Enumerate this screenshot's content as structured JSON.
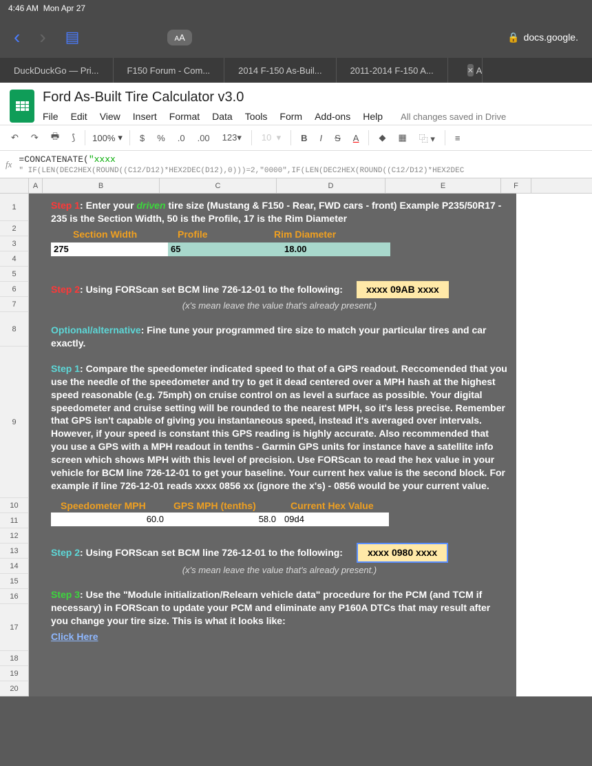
{
  "status": {
    "time": "4:46 AM",
    "date": "Mon Apr 27"
  },
  "browser": {
    "url_domain": "docs.google.",
    "font_label": "AA"
  },
  "tabs": [
    "DuckDuckGo — Pri...",
    "F150 Forum - Com...",
    "2014 F-150 As-Buil...",
    "2011-2014 F-150 A...",
    "A"
  ],
  "doc": {
    "title": "Ford As-Built Tire Calculator v3.0",
    "menus": [
      "File",
      "Edit",
      "View",
      "Insert",
      "Format",
      "Data",
      "Tools",
      "Form",
      "Add-ons",
      "Help"
    ],
    "save_status": "All changes saved in Drive",
    "zoom": "100%"
  },
  "formula": {
    "prefix": "=CONCATENATE(",
    "string": "\"xxxx",
    "line2": "\" IF(LEN(DEC2HEX(ROUND((C12/D12)*HEX2DEC(D12),0)))=2,\"0000\",IF(LEN(DEC2HEX(ROUND((C12/D12)*HEX2DEC"
  },
  "columns": [
    "A",
    "B",
    "C",
    "D",
    "E",
    "F"
  ],
  "rows": [
    "1",
    "2",
    "3",
    "4",
    "5",
    "6",
    "7",
    "8",
    "9",
    "10",
    "11",
    "12",
    "13",
    "14",
    "15",
    "16",
    "17",
    "18",
    "19",
    "20"
  ],
  "sheet": {
    "step1_a": "Step 1",
    "step1_b": ": Enter your ",
    "step1_c": "driven",
    "step1_d": " tire size (Mustang & F150 - Rear, FWD cars - front)  Example P235/50R17 - 235 is the Section Width, 50 is the Profile, 17 is the Rim Diameter",
    "labels": {
      "sw": "Section Width",
      "pr": "Profile",
      "rd": "Rim Diameter"
    },
    "inputs": {
      "sw": "275",
      "pr": "65",
      "rd": "18.00"
    },
    "step2_a": "Step 2",
    "step2_b": ": Using FORScan set BCM line 726-12-01 to the following:",
    "result1": "xxxx 09AB xxxx",
    "note": "(x's mean leave the value that's already present.)",
    "opt_a": "Optional/alternative",
    "opt_b": ": Fine tune your programmed tire size to match your particular tires and car exactly.",
    "alt_s1_a": "Step 1",
    "alt_s1_b": ": Compare the speedometer indicated speed to that of a GPS readout. Reccomended that you use the needle of the speedometer and try to get it dead centered over a MPH hash at the highest speed reasonable (e.g. 75mph) on cruise control on as level a surface as possible. Your digital speedometer and cruise setting will be rounded to the nearest MPH, so it's less precise. Remember that GPS isn't capable of giving you instantaneous speed, instead it's averaged over intervals. However, if your speed is constant this GPS reading is highly accurate.  Also recommended that you use a GPS with a MPH readout in tenths - Garmin GPS units for instance have a satellite info screen which shows MPH with this level of precision.  Use FORScan to read the hex value in your vehicle for BCM line 726-12-01 to get your baseline.  Your current hex value is the second block.  For example if line 726-12-01 reads xxxx 0856 xx (ignore the x's) - 0856 would be your current value.",
    "labels2": {
      "sp": "Speedometer MPH",
      "gps": "GPS MPH (tenths)",
      "hex": "Current Hex Value"
    },
    "inputs2": {
      "sp": "60.0",
      "gps": "58.0",
      "hex": "09d4"
    },
    "alt_s2_a": "Step 2",
    "alt_s2_b": ": Using FORScan set BCM line 726-12-01 to the following:",
    "result2": "xxxx 0980 xxxx",
    "s3_a": "Step 3",
    "s3_b": ": Use the \"Module initialization/Relearn vehicle data\" procedure for the PCM (and TCM if necessary) in FORScan to update your PCM and eliminate any P160A DTCs that may result after you change your tire size.  This is what it looks like:",
    "link": "Click Here"
  }
}
